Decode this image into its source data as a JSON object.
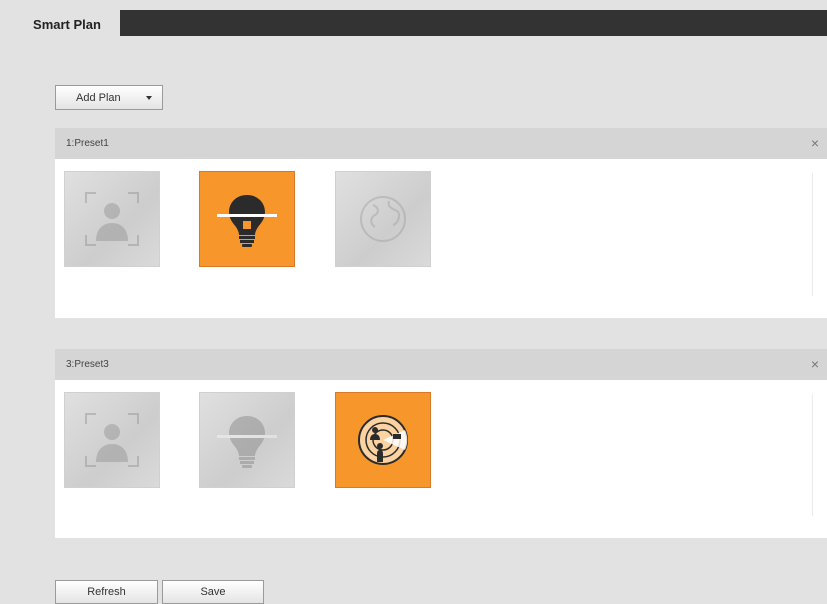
{
  "tabs": {
    "active_label": "Smart Plan"
  },
  "toolbar": {
    "add_plan_label": "Add Plan"
  },
  "presets": [
    {
      "title": "1:Preset1",
      "close_symbol": "×",
      "tiles": [
        {
          "icon": "face-detection-icon",
          "state": "inactive"
        },
        {
          "icon": "bulb-icon",
          "state": "active"
        },
        {
          "icon": "globe-icon",
          "state": "inactive"
        }
      ]
    },
    {
      "title": "3:Preset3",
      "close_symbol": "×",
      "tiles": [
        {
          "icon": "face-detection-icon",
          "state": "inactive"
        },
        {
          "icon": "bulb-icon",
          "state": "inactive"
        },
        {
          "icon": "radar-icon",
          "state": "active"
        }
      ]
    }
  ],
  "footer": {
    "refresh_label": "Refresh",
    "save_label": "Save"
  },
  "colors": {
    "active": "#f7962a",
    "tabbar": "#333333",
    "background": "#e2e2e2"
  }
}
